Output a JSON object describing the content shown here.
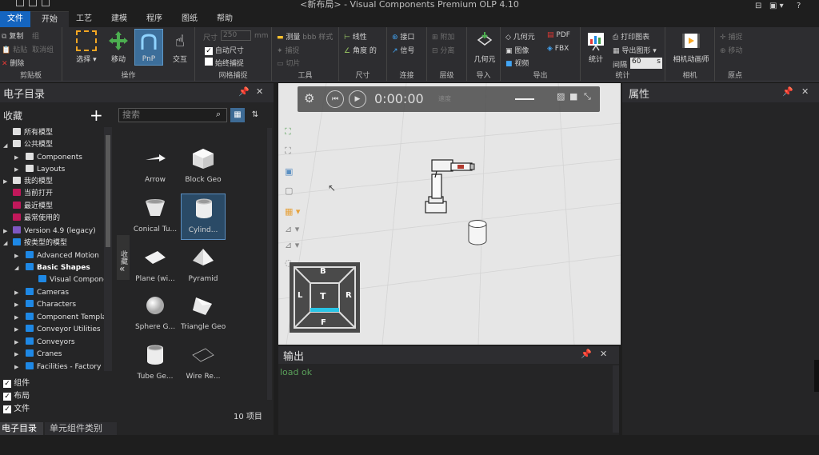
{
  "window": {
    "title": "<新布局> - Visual Components Premium OLP 4.10"
  },
  "menu": {
    "file": "文件",
    "start": "开始",
    "items": [
      "工艺",
      "建模",
      "程序",
      "图纸",
      "帮助"
    ]
  },
  "ribbon": {
    "clipboard": {
      "label": "剪贴板",
      "copy": "复制",
      "paste": "粘贴",
      "delete": "删除",
      "group": "组",
      "ungroup": "取消组"
    },
    "manipulate": {
      "label": "操作",
      "select": "选择",
      "move": "移动",
      "pnp": "PnP",
      "interact": "交互"
    },
    "grid_snap": {
      "label": "网格捕捉",
      "size_label": "尺寸",
      "size_value": "250",
      "size_unit": "mm",
      "auto_size": "自动尺寸",
      "always_snap": "始终捕捉"
    },
    "tools": {
      "label": "工具",
      "measure": "测量",
      "measure_mode": "bbb 样式",
      "capture": "捕捉",
      "cut": "切片"
    },
    "dimension": {
      "label": "尺寸",
      "linear": "线性",
      "angle": "角度 的"
    },
    "connect": {
      "label": "连接",
      "interface": "接口",
      "signal": "信号"
    },
    "layers": {
      "label": "层级",
      "attach": "附加",
      "detach": "分离"
    },
    "import": {
      "label": "导入",
      "geometry": "几何元"
    },
    "export": {
      "label": "导出",
      "geometry": "几何元",
      "image": "图像",
      "video": "视频",
      "pdf": "PDF",
      "fbx": "FBX"
    },
    "stats": {
      "label": "统计",
      "stats": "统计",
      "print_chart": "打印图表",
      "export_chart": "导出图形",
      "interval": "间隔",
      "interval_value": "60",
      "unit": "s"
    },
    "camera": {
      "label": "相机",
      "animator": "相机动画师"
    },
    "origin": {
      "label": "原点",
      "snap": "捕捉",
      "move": "移动"
    }
  },
  "catalog": {
    "title": "电子目录",
    "favorites": "收藏",
    "search_placeholder": "搜索",
    "tree": [
      "所有模型",
      "公共模型",
      "Components",
      "Layouts",
      "我的模型",
      "当前打开",
      "最近模型",
      "最常使用的",
      "Version 4.9 (legacy)",
      "按类型的模型",
      "Advanced Motion",
      "Basic Shapes",
      "Visual Components",
      "Cameras",
      "Characters",
      "Component Templates",
      "Conveyor Utilities",
      "Conveyors",
      "Cranes",
      "Facilities - Factory"
    ],
    "tiles": [
      "Arrow",
      "Block Geo",
      "Conical Tu...",
      "Cylind...",
      "Plane (wi...",
      "Pyramid",
      "Sphere G...",
      "Triangle Geo",
      "Tube Ge...",
      "Wire Re..."
    ],
    "side_tab": "收藏",
    "filters": [
      "组件",
      "布局",
      "文件"
    ],
    "count": "10 项目",
    "bottom_tabs": [
      "电子目录",
      "单元组件类别"
    ]
  },
  "viewport": {
    "time": "0:00:00",
    "speed_label": "速度",
    "cube": {
      "top": "T",
      "back": "B",
      "left": "L",
      "right": "R",
      "front": "F"
    }
  },
  "output": {
    "title": "输出",
    "log": "load ok"
  },
  "properties": {
    "title": "属性"
  },
  "colors": {
    "accent": "#1565c0",
    "selection": "#2a4a66",
    "log_text": "#5aa05a",
    "folder_red": "#c2185b",
    "folder_blue": "#1e88e5",
    "folder_purple": "#7e57c2"
  }
}
